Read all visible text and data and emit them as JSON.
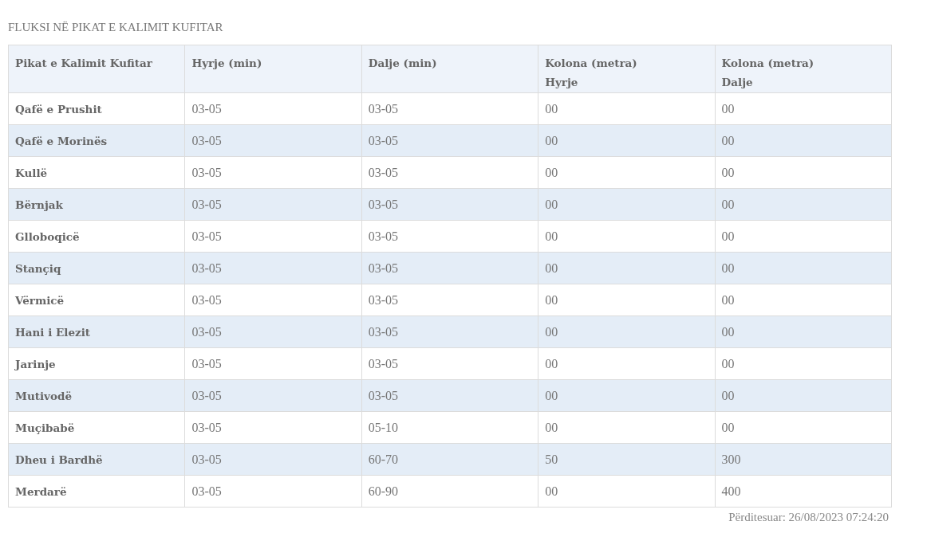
{
  "title": "FLUKSI NË PIKAT E KALIMIT KUFITAR",
  "table": {
    "columns": [
      "Pikat e Kalimit Kufitar",
      "Hyrje (min)",
      "Dalje (min)",
      "Kolona (metra)\nHyrje",
      "Kolona (metra)\nDalje"
    ],
    "rows": [
      [
        "Qafë e Prushit",
        "03-05",
        "03-05",
        "00",
        "00"
      ],
      [
        "Qafë e Morinës",
        "03-05",
        "03-05",
        "00",
        "00"
      ],
      [
        "Kullë",
        "03-05",
        "03-05",
        "00",
        "00"
      ],
      [
        "Bërnjak",
        "03-05",
        "03-05",
        "00",
        "00"
      ],
      [
        "Glloboqicë",
        "03-05",
        "03-05",
        "00",
        "00"
      ],
      [
        "Stançiq",
        "03-05",
        "03-05",
        "00",
        "00"
      ],
      [
        "Vërmicë",
        "03-05",
        "03-05",
        "00",
        "00"
      ],
      [
        "Hani i Elezit",
        "03-05",
        "03-05",
        "00",
        "00"
      ],
      [
        "Jarinje",
        "03-05",
        "03-05",
        "00",
        "00"
      ],
      [
        "Mutivodë",
        "03-05",
        "03-05",
        "00",
        "00"
      ],
      [
        "Muçibabë",
        "03-05",
        "05-10",
        "00",
        "00"
      ],
      [
        "Dheu i Bardhë",
        "03-05",
        "60-70",
        "50",
        "300"
      ],
      [
        "Merdarë",
        "03-05",
        "60-90",
        "00",
        "400"
      ]
    ]
  },
  "updated": "Përditesuar: 26/08/2023 07:24:20"
}
